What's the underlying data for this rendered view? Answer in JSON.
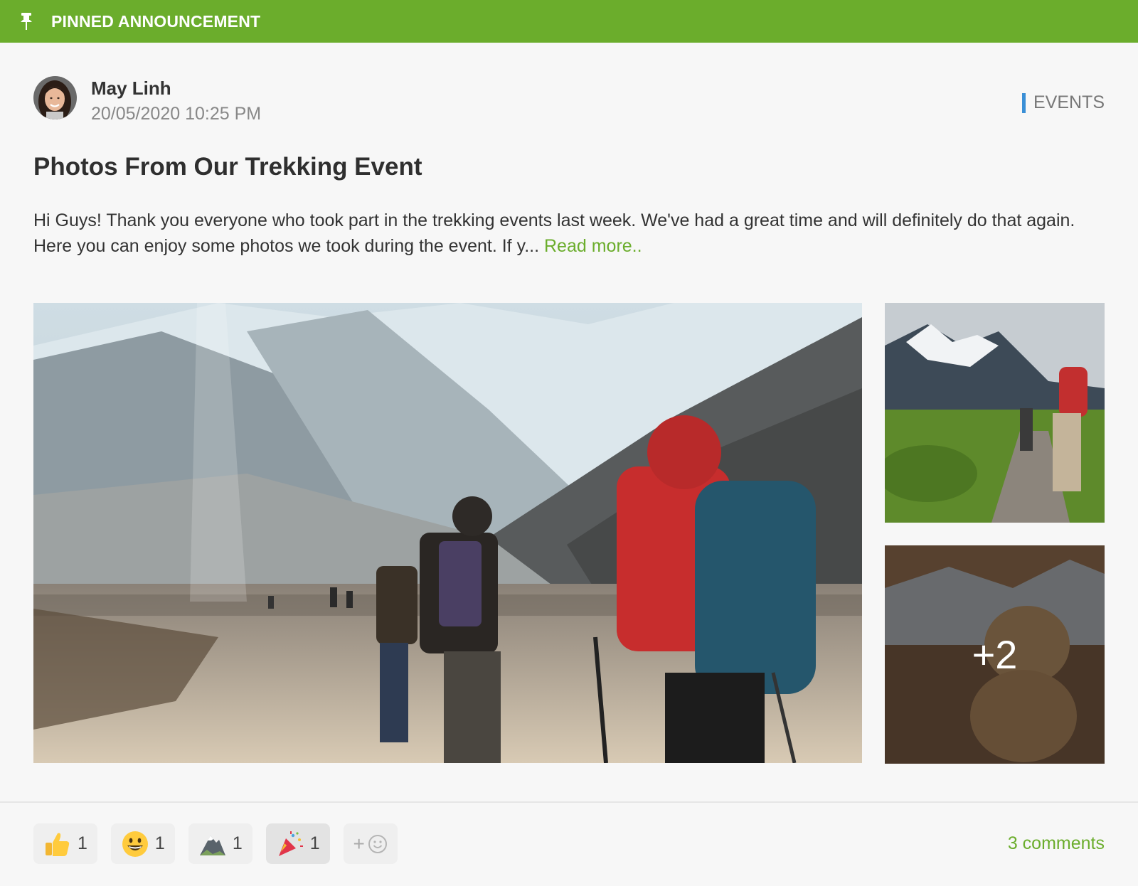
{
  "banner": {
    "label": "PINNED ANNOUNCEMENT",
    "icon": "pin-icon",
    "color": "#6bad2c"
  },
  "post": {
    "author": "May Linh",
    "date": "20/05/2020 10:25 PM",
    "category": "EVENTS",
    "category_color": "#3a8fd6",
    "title": "Photos From Our Trekking Event",
    "body": "Hi Guys! Thank you everyone who took part in the trekking events last week. We've had a great time and will definitely do that again. Here you can enjoy some photos we took during the event. If y... ",
    "read_more": "Read more.."
  },
  "gallery": {
    "more_count": "+2"
  },
  "reactions": [
    {
      "icon": "thumbs-up-icon",
      "count": "1"
    },
    {
      "icon": "grinning-face-icon",
      "count": "1"
    },
    {
      "icon": "mountain-icon",
      "count": "1"
    },
    {
      "icon": "party-popper-icon",
      "count": "1"
    }
  ],
  "add_reaction": {
    "icon": "add-emoji-icon",
    "plus": "+"
  },
  "comments": "3 comments"
}
